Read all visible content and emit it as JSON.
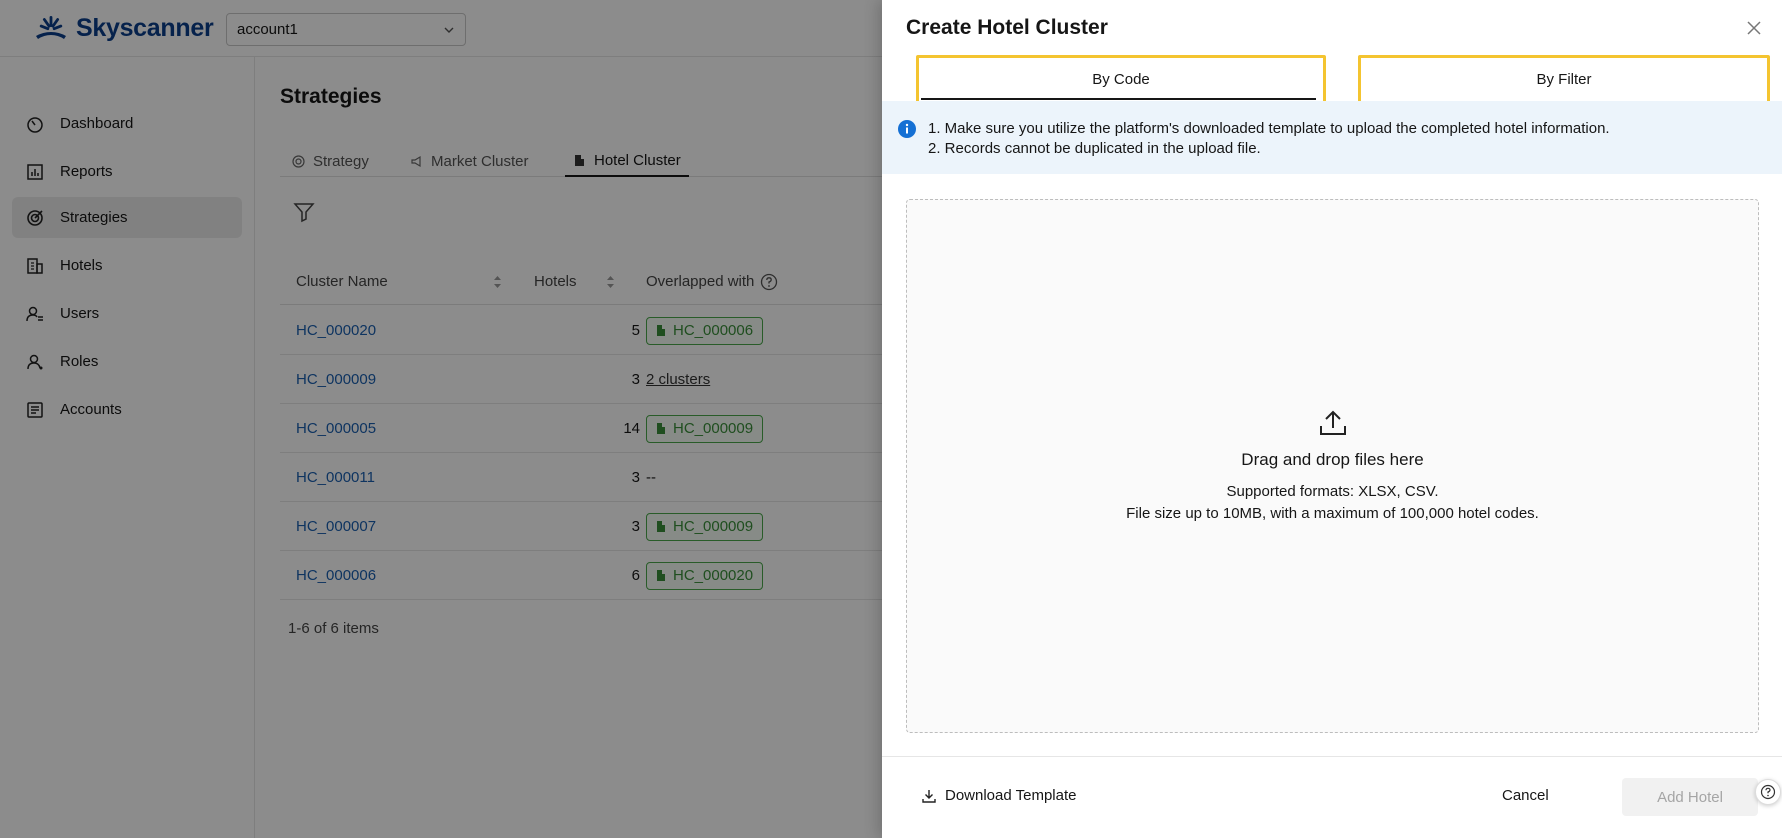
{
  "brand": {
    "name": "Skyscanner",
    "color": "#0b3e8a"
  },
  "account_select": {
    "value": "account1"
  },
  "sidebar": {
    "items": [
      {
        "label": "Dashboard",
        "icon": "dashboard-icon"
      },
      {
        "label": "Reports",
        "icon": "reports-icon"
      },
      {
        "label": "Strategies",
        "icon": "strategies-icon",
        "active": true
      },
      {
        "label": "Hotels",
        "icon": "hotels-icon"
      },
      {
        "label": "Users",
        "icon": "users-icon"
      },
      {
        "label": "Roles",
        "icon": "roles-icon"
      },
      {
        "label": "Accounts",
        "icon": "accounts-icon"
      }
    ]
  },
  "page": {
    "title": "Strategies",
    "tabs": [
      {
        "label": "Strategy"
      },
      {
        "label": "Market Cluster"
      },
      {
        "label": "Hotel Cluster",
        "active": true
      }
    ]
  },
  "table": {
    "headers": {
      "name": "Cluster Name",
      "hotels": "Hotels",
      "overlap": "Overlapped with"
    },
    "rows": [
      {
        "name": "HC_000020",
        "hotels": "5",
        "overlap": "HC_000006",
        "overlap_type": "tag"
      },
      {
        "name": "HC_000009",
        "hotels": "3",
        "overlap": "2 clusters",
        "overlap_type": "link"
      },
      {
        "name": "HC_000005",
        "hotels": "14",
        "overlap": "HC_000009",
        "overlap_type": "tag"
      },
      {
        "name": "HC_000011",
        "hotels": "3",
        "overlap": "--",
        "overlap_type": "text"
      },
      {
        "name": "HC_000007",
        "hotels": "3",
        "overlap": "HC_000009",
        "overlap_type": "tag"
      },
      {
        "name": "HC_000006",
        "hotels": "6",
        "overlap": "HC_000020",
        "overlap_type": "tag"
      }
    ],
    "pagination": "1-6 of 6 items"
  },
  "drawer": {
    "title": "Create Hotel Cluster",
    "segments": [
      {
        "label": "By Code",
        "active": true
      },
      {
        "label": "By Filter"
      }
    ],
    "info": {
      "line1": "1. Make sure you utilize the platform's downloaded template to upload the completed hotel information.",
      "line2": "2. Records cannot be duplicated in the upload file."
    },
    "dropzone": {
      "title": "Drag and drop files here",
      "formats": "Supported formats: XLSX, CSV.",
      "limit": "File size up to 10MB, with a maximum of 100,000 hotel codes."
    },
    "footer": {
      "download": "Download Template",
      "cancel": "Cancel",
      "add": "Add Hotel"
    }
  },
  "colors": {
    "link": "#1b5fb0",
    "tag_green": "#3a8f3a",
    "highlight": "#f4c430",
    "info_bg": "#ecf4fb",
    "info_blue": "#1570d4"
  }
}
